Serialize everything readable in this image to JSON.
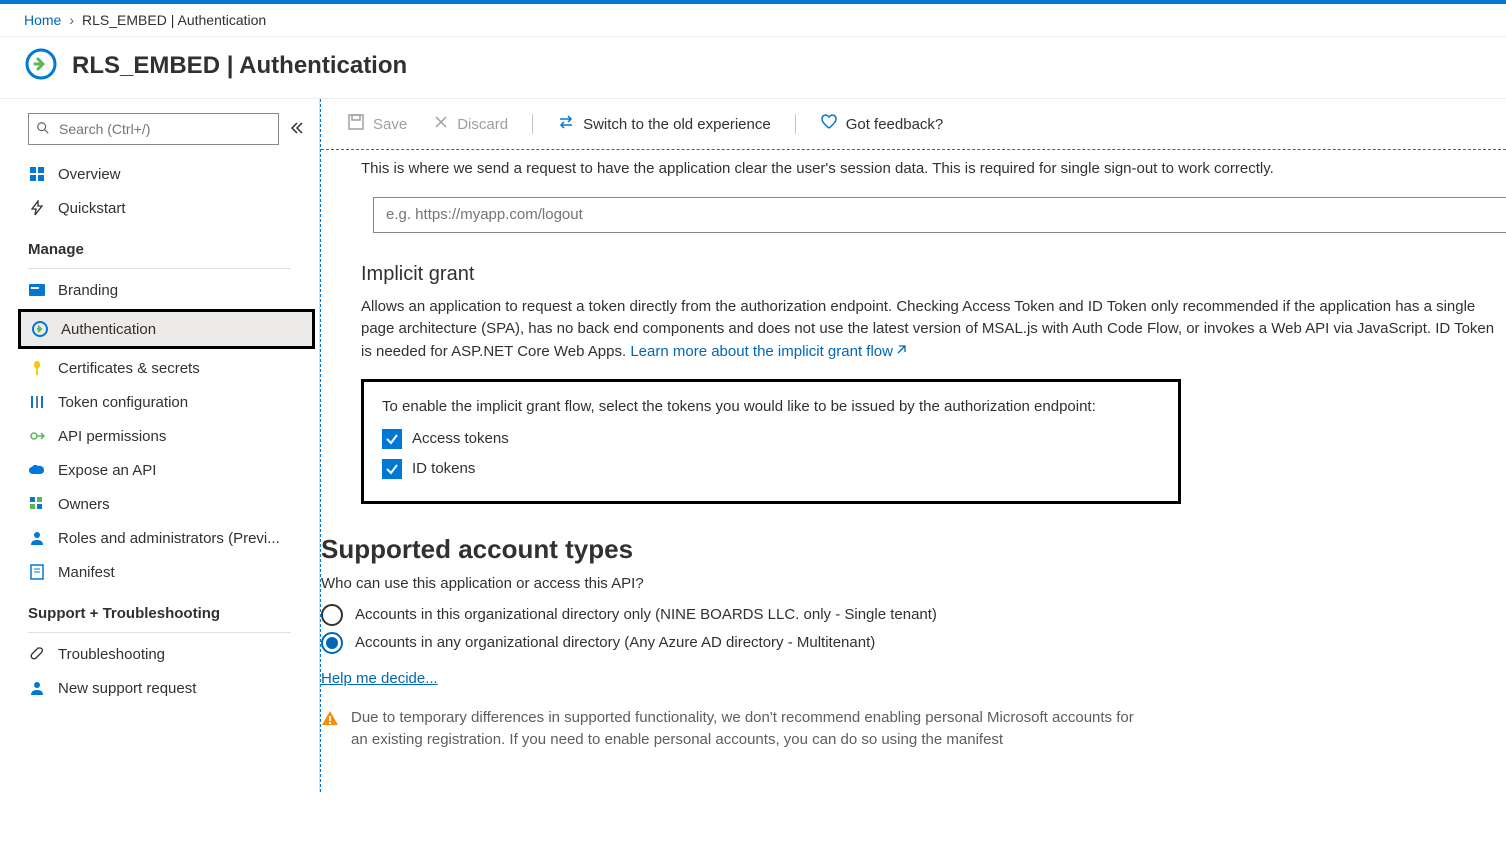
{
  "breadcrumb": {
    "home": "Home",
    "current": "RLS_EMBED | Authentication"
  },
  "header": {
    "title": "RLS_EMBED | Authentication"
  },
  "sidebar": {
    "search_placeholder": "Search (Ctrl+/)",
    "overview": "Overview",
    "quickstart": "Quickstart",
    "manage_heading": "Manage",
    "branding": "Branding",
    "authentication": "Authentication",
    "certificates": "Certificates & secrets",
    "token_config": "Token configuration",
    "api_permissions": "API permissions",
    "expose_api": "Expose an API",
    "owners": "Owners",
    "roles": "Roles and administrators (Previ...",
    "manifest": "Manifest",
    "support_heading": "Support + Troubleshooting",
    "troubleshooting": "Troubleshooting",
    "new_support": "New support request"
  },
  "toolbar": {
    "save": "Save",
    "discard": "Discard",
    "switch": "Switch to the old experience",
    "feedback": "Got feedback?"
  },
  "logout": {
    "description": "This is where we send a request to have the application clear the user's session data. This is required for single sign-out to work correctly.",
    "placeholder": "e.g. https://myapp.com/logout"
  },
  "implicit": {
    "heading": "Implicit grant",
    "desc_pre": "Allows an application to request a token directly from the authorization endpoint. Checking Access Token and ID Token only recommended if the application has a single page architecture (SPA), has no back end components and does not use the latest version of MSAL.js with Auth Code Flow, or invokes a Web API via JavaScript. ID Token is needed for ASP.NET Core Web Apps. ",
    "link": "Learn more about the implicit grant flow",
    "enable_text": "To enable the implicit grant flow, select the tokens you would like to be issued by the authorization endpoint:",
    "access_tokens": "Access tokens",
    "id_tokens": "ID tokens"
  },
  "supported": {
    "heading": "Supported account types",
    "question": "Who can use this application or access this API?",
    "opt1": "Accounts in this organizational directory only (NINE BOARDS LLC. only - Single tenant)",
    "opt2": "Accounts in any organizational directory (Any Azure AD directory - Multitenant)",
    "help": "Help me decide...",
    "warning": "Due to temporary differences in supported functionality, we don't recommend enabling personal Microsoft accounts for an existing registration. If you need to enable personal accounts, you can do so using the manifest"
  }
}
